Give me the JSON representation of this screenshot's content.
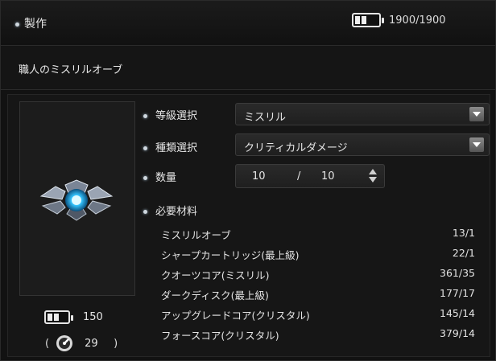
{
  "window": {
    "title": "製作",
    "energy": "1900/1900"
  },
  "item": {
    "name": "職人のミスリルオーブ",
    "energy_cost": "150",
    "paren_open": "(",
    "paren_close": ")",
    "gauge_value": "29"
  },
  "form": {
    "grade_label": "等級選択",
    "grade_value": "ミスリル",
    "type_label": "種類選択",
    "type_value": "クリティカルダメージ",
    "quantity_label": "数量",
    "quantity_current": "10",
    "quantity_separator": "/",
    "quantity_max": "10",
    "materials_label": "必要材料"
  },
  "materials": [
    {
      "name": "ミスリルオーブ",
      "count": "13/1"
    },
    {
      "name": "シャープカートリッジ(最上級)",
      "count": "22/1"
    },
    {
      "name": "クオーツコア(ミスリル)",
      "count": "361/35"
    },
    {
      "name": "ダークディスク(最上級)",
      "count": "177/17"
    },
    {
      "name": "アップグレードコア(クリスタル)",
      "count": "145/14"
    },
    {
      "name": "フォースコア(クリスタル)",
      "count": "379/14"
    }
  ],
  "colors": {
    "background": "#121212",
    "accent_orb": "#36c6ff",
    "text": "#e6e6e6"
  },
  "icons": [
    "battery-icon",
    "dropdown-arrow-icon",
    "spinner-icon",
    "gauge-icon",
    "bullet-icon",
    "orb-icon"
  ]
}
